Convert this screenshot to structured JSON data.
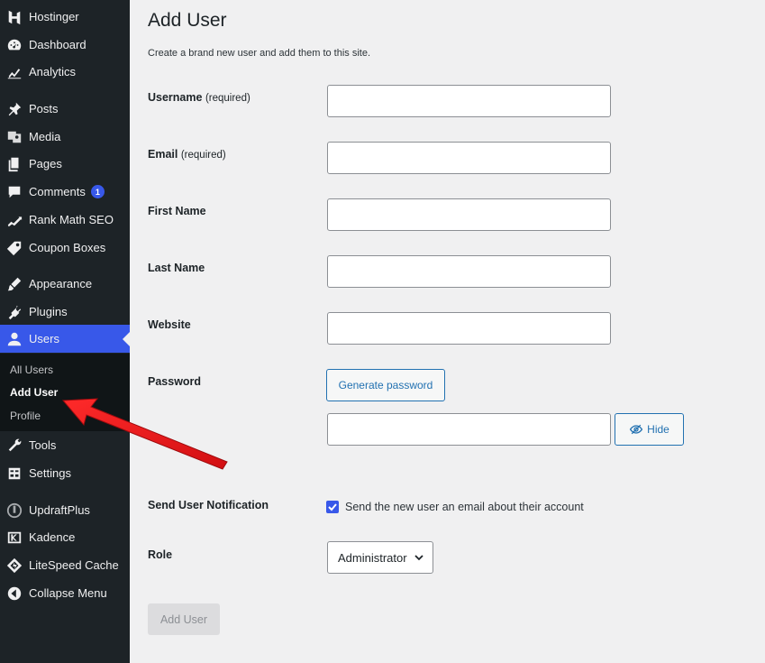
{
  "sidebar": {
    "items": [
      {
        "label": "Hostinger",
        "icon": "hostinger-icon"
      },
      {
        "label": "Dashboard",
        "icon": "dashboard-icon"
      },
      {
        "label": "Analytics",
        "icon": "analytics-icon"
      },
      {
        "label": "Posts",
        "icon": "pin-icon"
      },
      {
        "label": "Media",
        "icon": "media-icon"
      },
      {
        "label": "Pages",
        "icon": "pages-icon"
      },
      {
        "label": "Comments",
        "icon": "comment-icon",
        "badge": "1"
      },
      {
        "label": "Rank Math SEO",
        "icon": "rank-math-icon"
      },
      {
        "label": "Coupon Boxes",
        "icon": "tag-icon"
      },
      {
        "label": "Appearance",
        "icon": "brush-icon"
      },
      {
        "label": "Plugins",
        "icon": "plug-icon"
      },
      {
        "label": "Users",
        "icon": "user-icon"
      },
      {
        "label": "Tools",
        "icon": "wrench-icon"
      },
      {
        "label": "Settings",
        "icon": "settings-icon"
      },
      {
        "label": "UpdraftPlus",
        "icon": "updraft-icon"
      },
      {
        "label": "Kadence",
        "icon": "kadence-icon"
      },
      {
        "label": "LiteSpeed Cache",
        "icon": "litespeed-icon"
      },
      {
        "label": "Collapse Menu",
        "icon": "collapse-icon"
      }
    ],
    "submenu": [
      "All Users",
      "Add User",
      "Profile"
    ]
  },
  "page": {
    "title": "Add User",
    "description": "Create a brand new user and add them to this site."
  },
  "form": {
    "username_label": "Username",
    "username_req": "(required)",
    "email_label": "Email",
    "email_req": "(required)",
    "first_name_label": "First Name",
    "last_name_label": "Last Name",
    "website_label": "Website",
    "password_label": "Password",
    "generate_password": "Generate password",
    "hide_button": "Hide",
    "notification_label": "Send User Notification",
    "notification_text": "Send the new user an email about their account",
    "role_label": "Role",
    "role_value": "Administrator",
    "submit_label": "Add User"
  },
  "colors": {
    "sidebar_bg": "#1d2327",
    "accent": "#3858e9",
    "annotation_arrow": "#e8141b"
  }
}
